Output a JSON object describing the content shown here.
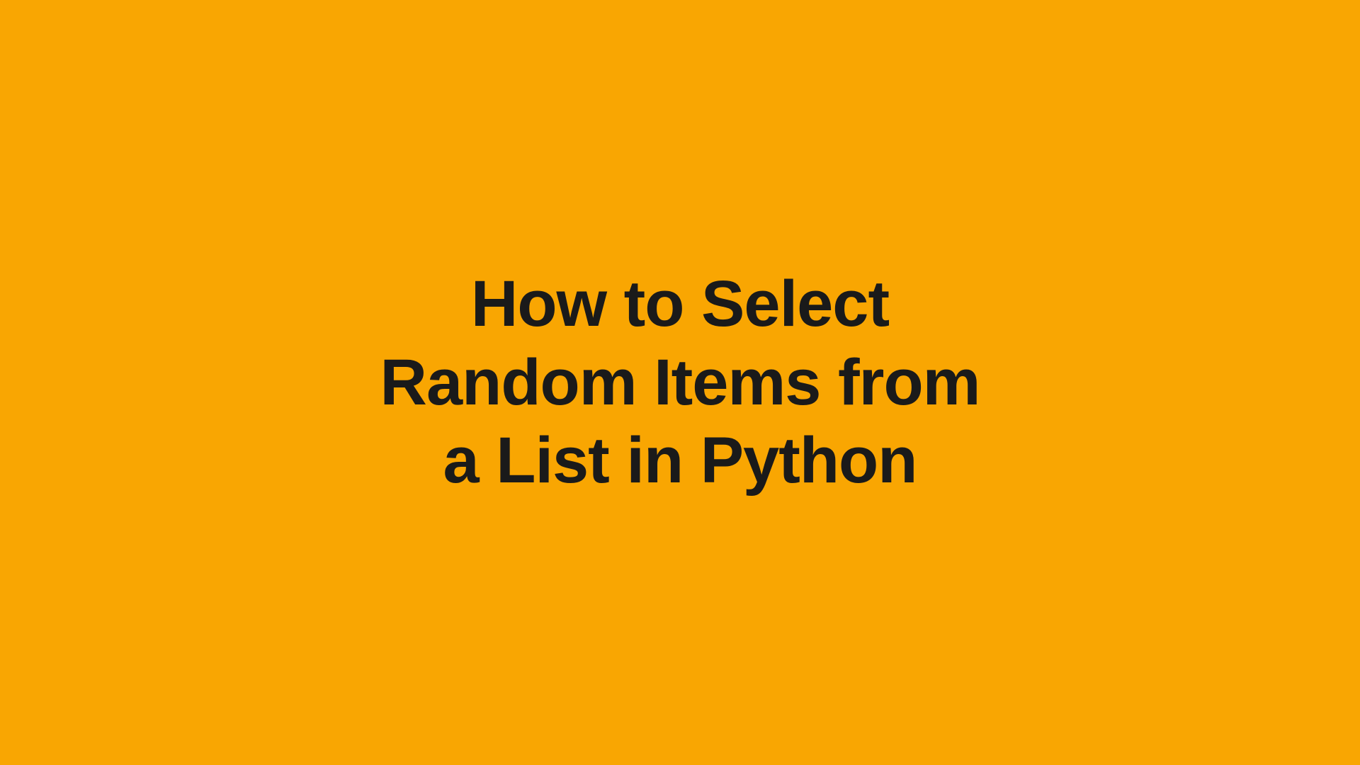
{
  "title": {
    "line1": "How to Select",
    "line2": "Random Items from",
    "line3": "a List in Python"
  },
  "colors": {
    "background": "#f9a602",
    "text": "#1a1a1a"
  }
}
